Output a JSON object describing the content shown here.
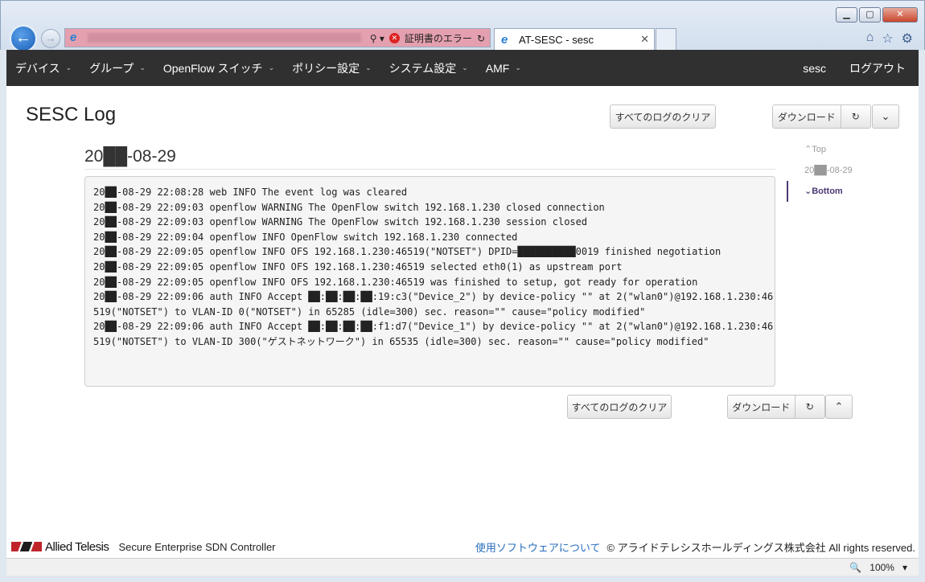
{
  "browser": {
    "cert_error_label": "証明書のエラー",
    "tab_title": "AT-SESC - sesc",
    "zoom": "100%"
  },
  "navbar": {
    "items": [
      {
        "label": "デバイス"
      },
      {
        "label": "グループ"
      },
      {
        "label": "OpenFlow スイッチ"
      },
      {
        "label": "ポリシー設定"
      },
      {
        "label": "システム設定"
      },
      {
        "label": "AMF"
      }
    ],
    "user": "sesc",
    "logout": "ログアウト"
  },
  "page": {
    "title": "SESC Log",
    "clear_all": "すべてのログのクリア",
    "download": "ダウンロード",
    "date_heading": "20██-08-29"
  },
  "side_nav": {
    "top": "Top",
    "date": "20██-08-29",
    "bottom": "Bottom"
  },
  "log_lines": [
    "20██-08-29 22:08:28 web INFO The event log was cleared",
    "20██-08-29 22:09:03 openflow WARNING The OpenFlow switch 192.168.1.230 closed connection",
    "20██-08-29 22:09:03 openflow WARNING The OpenFlow switch 192.168.1.230 session closed",
    "20██-08-29 22:09:04 openflow INFO OpenFlow switch 192.168.1.230 connected",
    "20██-08-29 22:09:05 openflow INFO OFS 192.168.1.230:46519(\"NOTSET\") DPID=██████████0019 finished negotiation",
    "20██-08-29 22:09:05 openflow INFO OFS 192.168.1.230:46519 selected eth0(1) as upstream port",
    "20██-08-29 22:09:05 openflow INFO OFS 192.168.1.230:46519 was finished to setup, got ready for operation",
    "20██-08-29 22:09:06 auth INFO Accept ██:██:██:██:19:c3(\"Device_2\") by device-policy \"\" at 2(\"wlan0\")@192.168.1.230:46",
    "519(\"NOTSET\") to VLAN-ID 0(\"NOTSET\") in 65285 (idle=300) sec. reason=\"\" cause=\"policy modified\"",
    "20██-08-29 22:09:06 auth INFO Accept ██:██:██:██:f1:d7(\"Device_1\") by device-policy \"\" at 2(\"wlan0\")@192.168.1.230:46",
    "519(\"NOTSET\") to VLAN-ID 300(\"ゲストネットワーク\") in 65535 (idle=300) sec. reason=\"\" cause=\"policy modified\""
  ],
  "footer": {
    "brand": "Allied Telesis",
    "product": "Secure Enterprise SDN Controller",
    "software_link": "使用ソフトウェアについて",
    "copyright": "© アライドテレシスホールディングス株式会社 All rights reserved."
  }
}
